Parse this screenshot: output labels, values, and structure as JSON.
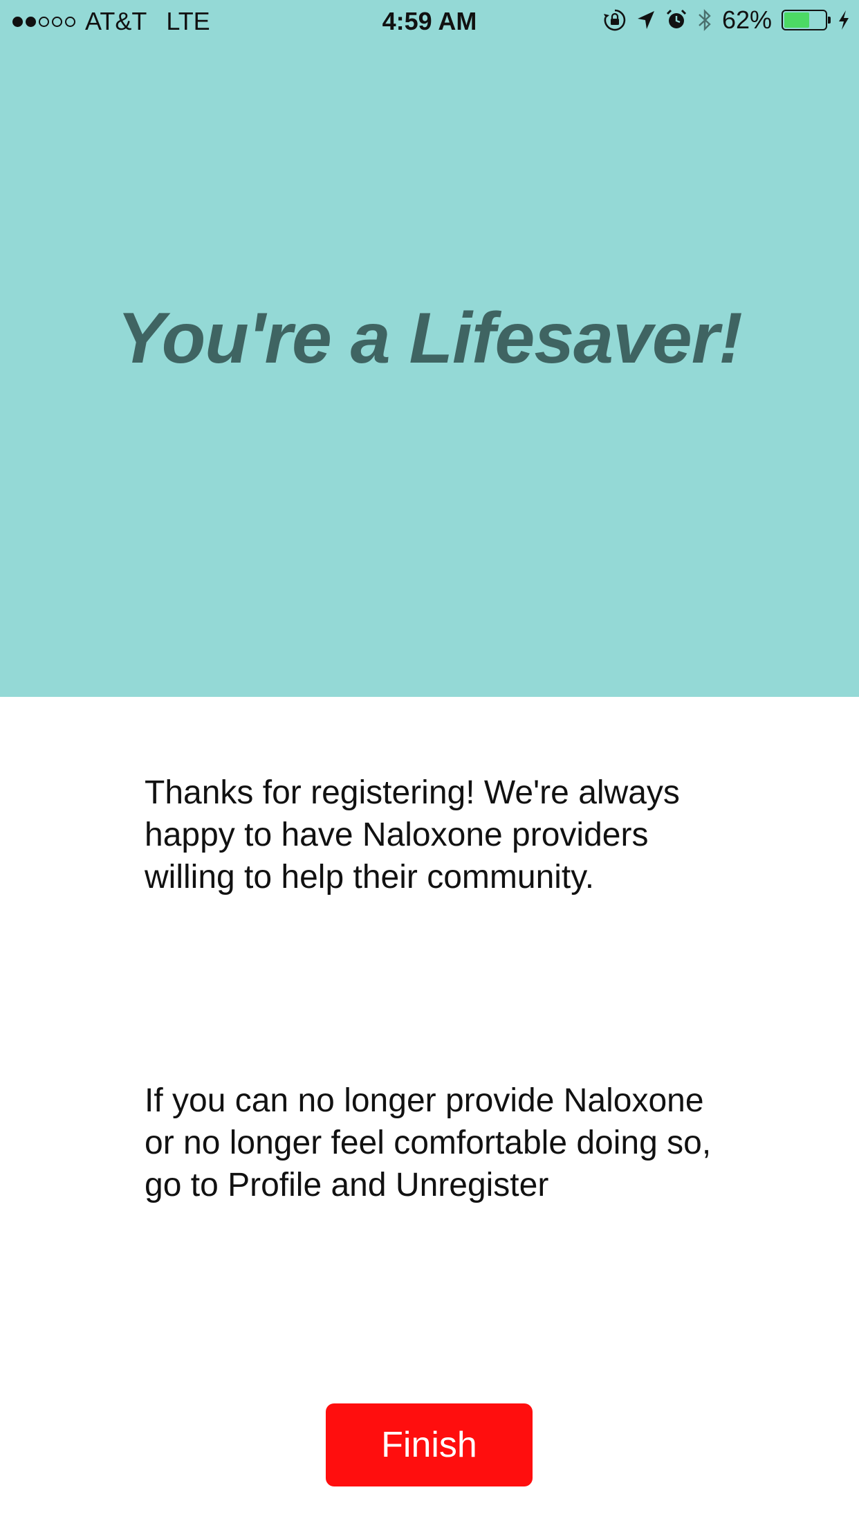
{
  "status_bar": {
    "carrier": "AT&T",
    "network": "LTE",
    "time": "4:59 AM",
    "battery_percent_text": "62%",
    "battery_level": 0.62,
    "signal_bars_filled": 2,
    "signal_bars_total": 5,
    "icons": [
      "rotation-lock-icon",
      "location-arrow-icon",
      "alarm-icon",
      "bluetooth-icon",
      "battery-icon",
      "charging-bolt-icon"
    ]
  },
  "hero": {
    "title": "You're a Lifesaver!"
  },
  "body": {
    "thanks_text": "Thanks for registering! We're always happy to have Naloxone providers willing to help their community.",
    "unregister_text": "If you can no longer provide Naloxone or no longer feel comfortable doing so, go to Profile and Unregister"
  },
  "actions": {
    "finish_label": "Finish"
  },
  "colors": {
    "hero_background": "#94d9d6",
    "headline": "#3f6462",
    "button": "#ff0e0e",
    "battery_fill": "#4cd964"
  }
}
